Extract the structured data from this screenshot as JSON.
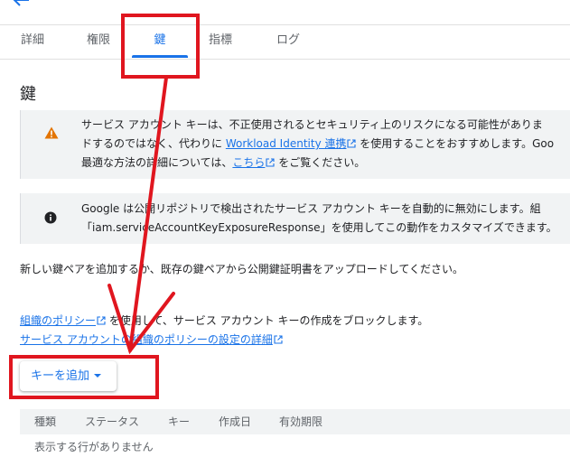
{
  "header": {
    "back_icon": "arrow-back-icon"
  },
  "tabs": [
    {
      "label": "詳細",
      "active": false
    },
    {
      "label": "権限",
      "active": false
    },
    {
      "label": "鍵",
      "active": true
    },
    {
      "label": "指標",
      "active": false
    },
    {
      "label": "ログ",
      "active": false
    }
  ],
  "main": {
    "title": "鍵",
    "warning": {
      "icon": "warning-icon",
      "line1": "サービス アカウント キーは、不正使用されるとセキュリティ上のリスクになる可能性がありま",
      "line2_pre": "ドするのではなく、代わりに ",
      "line2_link": "Workload Identity 連携",
      "line2_post": " を使用することをおすすめします。Goo",
      "line3_pre": "最適な方法の詳細については、",
      "line3_link": "こちら",
      "line3_post": " をご覧ください。"
    },
    "info": {
      "icon": "info-icon",
      "line1": "Google は公開リポジトリで検出されたサービス アカウント キーを自動的に無効にします。組",
      "line2": "「iam.serviceAccountKeyExposureResponse」を使用してこの動作をカスタマイズできます。"
    },
    "description": "新しい鍵ペアを追加するか、既存の鍵ペアから公開鍵証明書をアップロードしてください。",
    "policy": {
      "link1": "組織のポリシー",
      "text1": " を使用して、サービス アカウント キーの作成をブロックします。",
      "link2": "サービス アカウントの組織のポリシーの設定の詳細"
    },
    "add_key_button": "キーを追加",
    "table": {
      "headers": [
        "種類",
        "ステータス",
        "キー",
        "作成日",
        "有効期限"
      ],
      "empty_message": "表示する行がありません"
    }
  },
  "colors": {
    "accent": "#1a73e8",
    "warning": "#e37400",
    "annotation": "#e0161f"
  }
}
